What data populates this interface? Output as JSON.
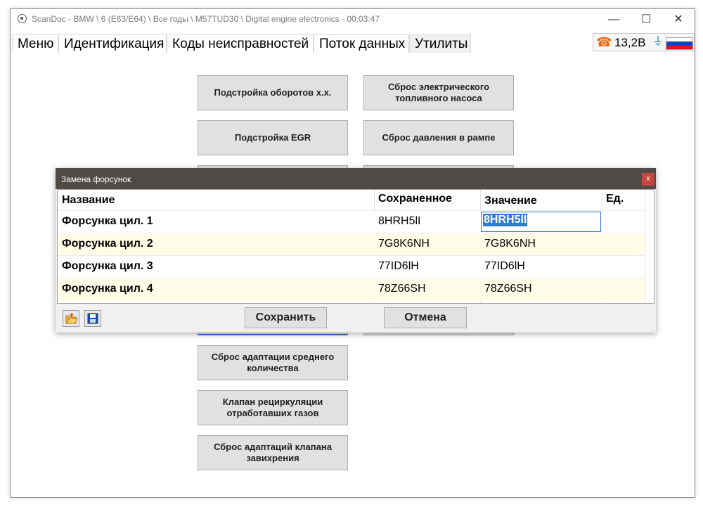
{
  "window": {
    "title": "ScanDoc - BMW \\ 6 (E63/E64) \\ Все годы \\ M57TUD30 \\ Digital engine electronics - 00:03:47",
    "minimize": "—",
    "maximize": "☐",
    "close": "✕"
  },
  "menu": {
    "tabs": [
      "Меню",
      "Идентификация",
      "Коды неисправностей",
      "Поток данных",
      "Утилиты"
    ]
  },
  "status": {
    "voltage": "13,2В"
  },
  "utilities": {
    "buttons": [
      "Подстройка оборотов х.х.",
      "Сброс электрического топливного насоса",
      "Подстройка EGR",
      "Сброс давления в рампе",
      "Сброс адаптации среднего количества",
      "Клапан рециркуляции отработавших газов",
      "Сброс адаптаций клапана завихрения"
    ]
  },
  "dialog": {
    "title": "Замена форсунок",
    "close": "x",
    "columns": [
      "Название",
      "Сохраненное",
      "Значение",
      "Ед."
    ],
    "rows": [
      {
        "name": "Форсунка цил. 1",
        "saved": "8HRH5lI",
        "value": "8HRH5lI",
        "unit": ""
      },
      {
        "name": "Форсунка цил. 2",
        "saved": "7G8K6NH",
        "value": "7G8K6NH",
        "unit": ""
      },
      {
        "name": "Форсунка цил. 3",
        "saved": "77ID6lH",
        "value": "77ID6lH",
        "unit": ""
      },
      {
        "name": "Форсунка цил. 4",
        "saved": "78Z66SH",
        "value": "78Z66SH",
        "unit": ""
      }
    ],
    "save_label": "Сохранить",
    "cancel_label": "Отмена"
  },
  "colors": {
    "alt_row": "#fffde8",
    "selection": "#2f7bd6",
    "dialog_titlebar": "#4f4b47"
  }
}
